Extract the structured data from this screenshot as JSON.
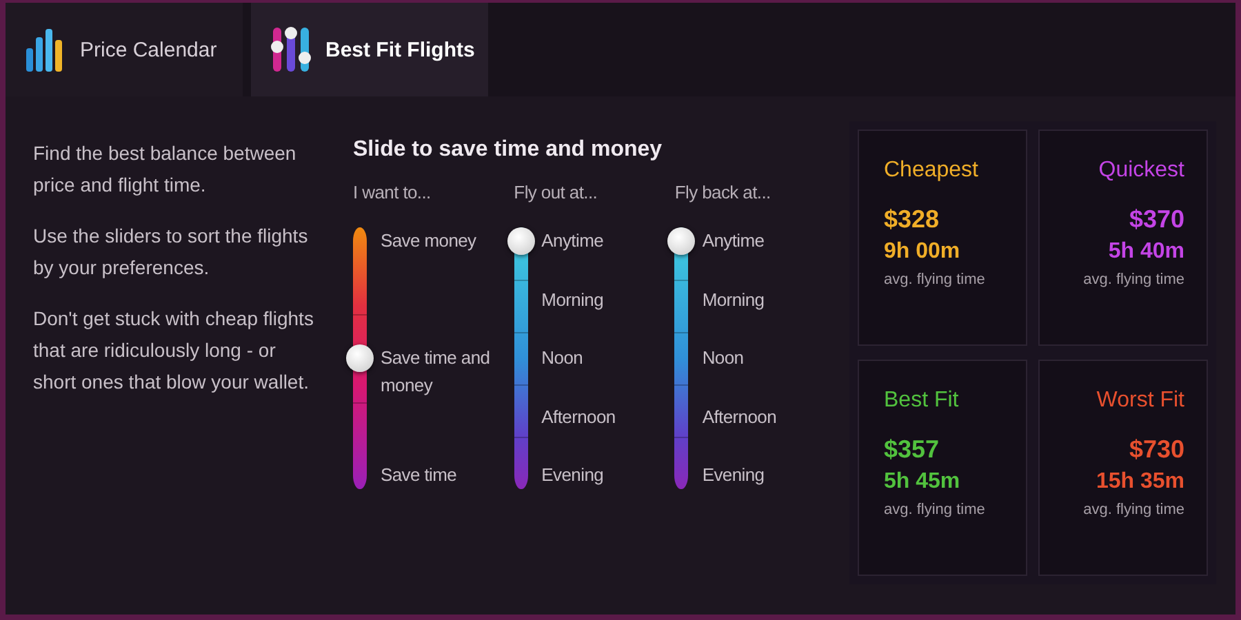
{
  "tabs": [
    {
      "label": "Price Calendar",
      "kind": "bars",
      "selected": false
    },
    {
      "label": "Best Fit Flights",
      "kind": "sliders",
      "selected": true
    }
  ],
  "intro": [
    "Find the best balance between price and flight time.",
    "Use the sliders to sort the flights by your preferences.",
    "Don't get stuck with cheap flights that are ridiculously long - or short ones that blow your wallet."
  ],
  "sliders_title": "Slide to save time and money",
  "sliders": [
    {
      "label": "I want to...",
      "kind": "warm",
      "options": [
        {
          "label": "Save money",
          "selected": false
        },
        {
          "label": "Save time and money",
          "selected": true
        },
        {
          "label": "Save time",
          "selected": false
        }
      ]
    },
    {
      "label": "Fly out at...",
      "kind": "cool",
      "options": [
        {
          "label": "Anytime",
          "selected": true
        },
        {
          "label": "Morning",
          "selected": false
        },
        {
          "label": "Noon",
          "selected": false
        },
        {
          "label": "Afternoon",
          "selected": false
        },
        {
          "label": "Evening",
          "selected": false
        }
      ]
    },
    {
      "label": "Fly back at...",
      "kind": "cool",
      "options": [
        {
          "label": "Anytime",
          "selected": true
        },
        {
          "label": "Morning",
          "selected": false
        },
        {
          "label": "Noon",
          "selected": false
        },
        {
          "label": "Afternoon",
          "selected": false
        },
        {
          "label": "Evening",
          "selected": false
        }
      ]
    }
  ],
  "cards": [
    {
      "title": "Cheapest",
      "price": "$328",
      "duration": "9h 00m",
      "note": "avg. flying time",
      "color": "#f0ae28"
    },
    {
      "title": "Quickest",
      "price": "$370",
      "duration": "5h 40m",
      "note": "avg. flying time",
      "color": "#c444e6"
    },
    {
      "title": "Best Fit",
      "price": "$357",
      "duration": "5h 45m",
      "note": "avg. flying time",
      "color": "#52c23e"
    },
    {
      "title": "Worst Fit",
      "price": "$730",
      "duration": "15h 35m",
      "note": "avg. flying time",
      "color": "#e8502e"
    }
  ]
}
